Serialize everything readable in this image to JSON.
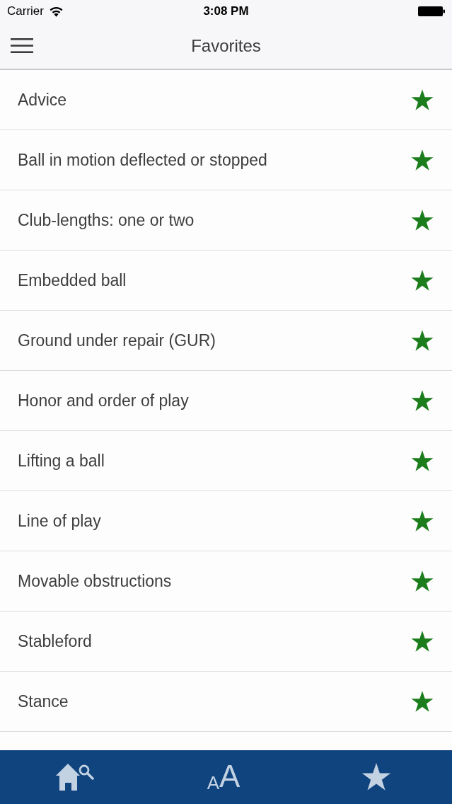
{
  "status_bar": {
    "carrier": "Carrier",
    "time": "3:08 PM"
  },
  "nav_bar": {
    "title": "Favorites"
  },
  "favorites": [
    {
      "title": "Advice",
      "favorite": true
    },
    {
      "title": "Ball in motion deflected or stopped",
      "favorite": true
    },
    {
      "title": "Club-lengths: one or two",
      "favorite": true
    },
    {
      "title": "Embedded ball",
      "favorite": true
    },
    {
      "title": "Ground under repair (GUR)",
      "favorite": true
    },
    {
      "title": "Honor and order of play",
      "favorite": true
    },
    {
      "title": "Lifting a ball",
      "favorite": true
    },
    {
      "title": "Line of play",
      "favorite": true
    },
    {
      "title": "Movable obstructions",
      "favorite": true
    },
    {
      "title": "Stableford",
      "favorite": true
    },
    {
      "title": "Stance",
      "favorite": true
    }
  ],
  "tab_bar": [
    {
      "kind": "home_search"
    },
    {
      "kind": "text_size",
      "small": "A",
      "large": "A"
    },
    {
      "kind": "favorites"
    }
  ]
}
